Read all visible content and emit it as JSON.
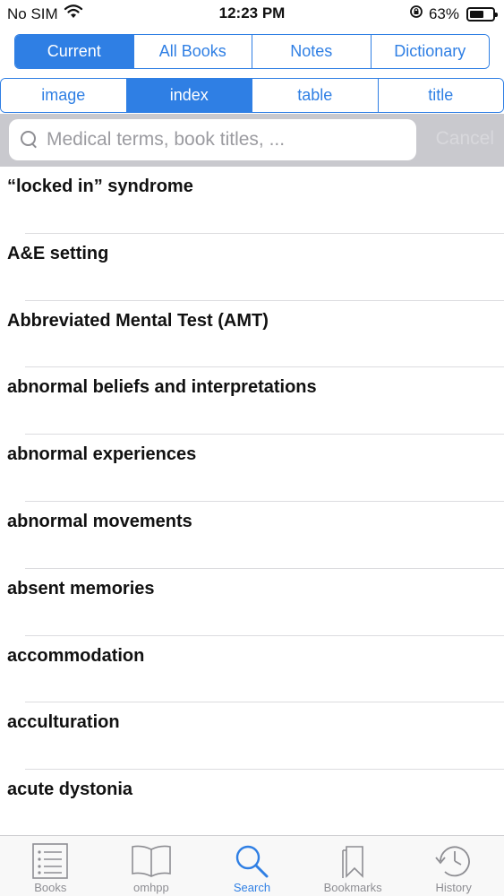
{
  "status_bar": {
    "carrier": "No SIM",
    "time": "12:23 PM",
    "battery_percent": "63%",
    "battery_level": 0.63,
    "icons": [
      "wifi-icon",
      "rotation-lock-icon",
      "battery-icon"
    ]
  },
  "scope_tabs": [
    {
      "label": "Current",
      "active": true
    },
    {
      "label": "All Books",
      "active": false
    },
    {
      "label": "Notes",
      "active": false
    },
    {
      "label": "Dictionary",
      "active": false
    }
  ],
  "type_tabs": [
    {
      "label": "image",
      "active": false
    },
    {
      "label": "index",
      "active": true
    },
    {
      "label": "table",
      "active": false
    },
    {
      "label": "title",
      "active": false
    }
  ],
  "search": {
    "placeholder": "Medical terms, book titles, ...",
    "value": "",
    "cancel_label": "Cancel"
  },
  "results": [
    {
      "label": "“locked in” syndrome"
    },
    {
      "label": "A&E setting"
    },
    {
      "label": "Abbreviated Mental Test (AMT)"
    },
    {
      "label": "abnormal beliefs and interpretations"
    },
    {
      "label": "abnormal experiences"
    },
    {
      "label": "abnormal movements"
    },
    {
      "label": "absent memories"
    },
    {
      "label": "accommodation"
    },
    {
      "label": "acculturation"
    },
    {
      "label": "acute dystonia"
    }
  ],
  "tab_bar": [
    {
      "label": "Books",
      "icon": "books-icon",
      "active": false
    },
    {
      "label": "omhpp",
      "icon": "open-book-icon",
      "active": false
    },
    {
      "label": "Search",
      "icon": "search-icon",
      "active": true
    },
    {
      "label": "Bookmarks",
      "icon": "bookmarks-icon",
      "active": false
    },
    {
      "label": "History",
      "icon": "history-icon",
      "active": false
    }
  ],
  "colors": {
    "accent": "#2f7fe4",
    "inactive": "#8e8e93",
    "search_bar_bg": "#c9c9ce"
  }
}
